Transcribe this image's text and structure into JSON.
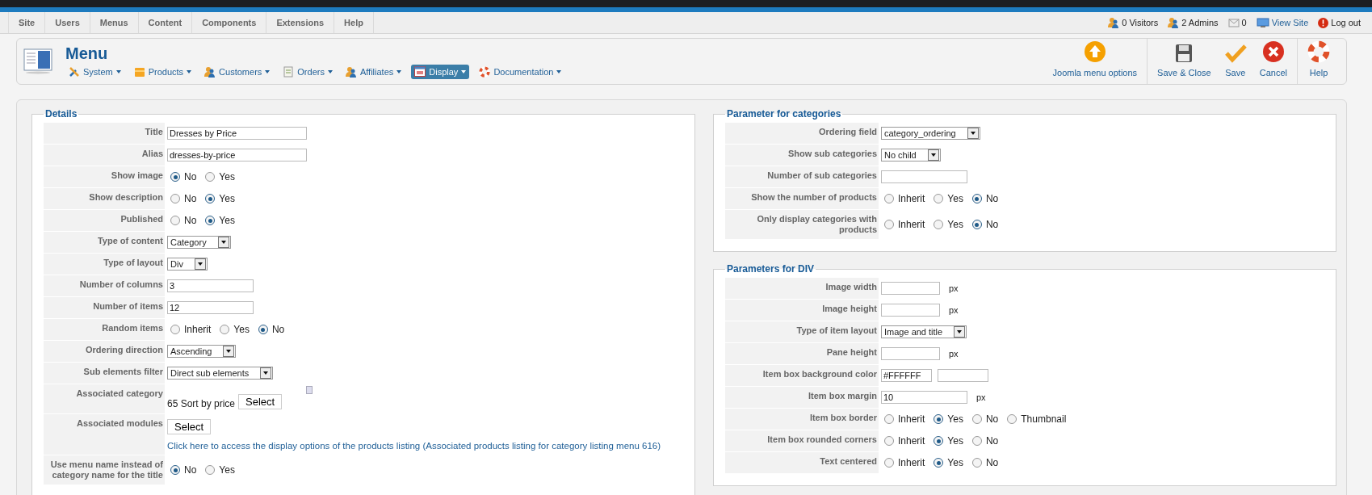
{
  "top_menu": [
    {
      "label": "Site"
    },
    {
      "label": "Users"
    },
    {
      "label": "Menus"
    },
    {
      "label": "Content"
    },
    {
      "label": "Components"
    },
    {
      "label": "Extensions"
    },
    {
      "label": "Help"
    }
  ],
  "status": [
    {
      "kind": "visitors",
      "label": "0 Visitors"
    },
    {
      "kind": "admins",
      "label": "2 Admins"
    },
    {
      "kind": "messages",
      "label": "0"
    },
    {
      "kind": "link",
      "label": "View Site"
    },
    {
      "kind": "logout",
      "label": "Log out"
    }
  ],
  "header": {
    "title": "Menu",
    "nav": [
      {
        "label": "System",
        "selected": false
      },
      {
        "label": "Products",
        "selected": false
      },
      {
        "label": "Customers",
        "selected": false
      },
      {
        "label": "Orders",
        "selected": false
      },
      {
        "label": "Affiliates",
        "selected": false
      },
      {
        "label": "Display",
        "selected": true
      },
      {
        "label": "Documentation",
        "selected": false
      }
    ]
  },
  "toolbar": [
    {
      "buttons": [
        {
          "label": "Joomla menu options"
        }
      ]
    },
    {
      "buttons": [
        {
          "label": "Save & Close"
        },
        {
          "label": "Save"
        },
        {
          "label": "Cancel"
        }
      ]
    },
    {
      "buttons": [
        {
          "label": "Help"
        }
      ]
    }
  ],
  "details": {
    "legend": "Details",
    "rows": [
      {
        "label": "Title",
        "kind": "text",
        "value": "Dresses by Price"
      },
      {
        "label": "Alias",
        "kind": "text",
        "value": "dresses-by-price"
      },
      {
        "label": "Show image",
        "kind": "radio",
        "options": [
          {
            "label": "No",
            "selected": true
          },
          {
            "label": "Yes",
            "selected": false
          }
        ]
      },
      {
        "label": "Show description",
        "kind": "radio",
        "options": [
          {
            "label": "No",
            "selected": false
          },
          {
            "label": "Yes",
            "selected": true
          }
        ]
      },
      {
        "label": "Published",
        "kind": "radio",
        "options": [
          {
            "label": "No",
            "selected": false
          },
          {
            "label": "Yes",
            "selected": true
          }
        ]
      },
      {
        "label": "Type of content",
        "kind": "select",
        "value": "Category"
      },
      {
        "label": "Type of layout",
        "kind": "select",
        "value": "Div"
      },
      {
        "label": "Number of columns",
        "kind": "number",
        "value": "3"
      },
      {
        "label": "Number of items",
        "kind": "number",
        "value": "12"
      },
      {
        "label": "Random items",
        "kind": "radio",
        "options": [
          {
            "label": "Inherit",
            "selected": false
          },
          {
            "label": "Yes",
            "selected": false
          },
          {
            "label": "No",
            "selected": true
          }
        ]
      },
      {
        "label": "Ordering direction",
        "kind": "select",
        "value": "Ascending"
      },
      {
        "label": "Sub elements filter",
        "kind": "select",
        "value": "Direct sub elements"
      },
      {
        "label": "Associated category",
        "kind": "category",
        "value": "65 Sort by price",
        "button": "Select"
      },
      {
        "label": "Associated modules",
        "kind": "modules",
        "button": "Select",
        "link": "Click here to access the display options of the products listing (Associated products listing for category listing menu 616)"
      },
      {
        "label": "Use menu name instead of category name for the title",
        "kind": "radio",
        "options": [
          {
            "label": "No",
            "selected": true
          },
          {
            "label": "Yes",
            "selected": false
          }
        ]
      }
    ]
  },
  "categories": {
    "legend": "Parameter for categories",
    "rows": [
      {
        "label": "Ordering field",
        "kind": "select",
        "value": "category_ordering"
      },
      {
        "label": "Show sub categories",
        "kind": "select",
        "value": "No child"
      },
      {
        "label": "Number of sub categories",
        "kind": "number"
      },
      {
        "label": "Show the number of products",
        "kind": "radio",
        "options": [
          {
            "label": "Inherit",
            "selected": false
          },
          {
            "label": "Yes",
            "selected": false
          },
          {
            "label": "No",
            "selected": true
          }
        ]
      },
      {
        "label": "Only display categories with products",
        "kind": "radio",
        "options": [
          {
            "label": "Inherit",
            "selected": false
          },
          {
            "label": "Yes",
            "selected": false
          },
          {
            "label": "No",
            "selected": true
          }
        ]
      }
    ]
  },
  "div": {
    "legend": "Parameters for DIV",
    "rows": [
      {
        "label": "Image width",
        "kind": "measure",
        "unit": "px"
      },
      {
        "label": "Image height",
        "kind": "measure",
        "unit": "px"
      },
      {
        "label": "Type of item layout",
        "kind": "select",
        "value": "Image and title"
      },
      {
        "label": "Pane height",
        "kind": "measure",
        "unit": "px"
      },
      {
        "label": "Item box background color",
        "kind": "color",
        "value": "#FFFFFF"
      },
      {
        "label": "Item box margin",
        "kind": "number",
        "value": "10",
        "unit": "px"
      },
      {
        "label": "Item box border",
        "kind": "radio",
        "options": [
          {
            "label": "Inherit",
            "selected": false
          },
          {
            "label": "Yes",
            "selected": true
          },
          {
            "label": "No",
            "selected": false
          },
          {
            "label": "Thumbnail",
            "selected": false
          }
        ]
      },
      {
        "label": "Item box rounded corners",
        "kind": "radio",
        "options": [
          {
            "label": "Inherit",
            "selected": false
          },
          {
            "label": "Yes",
            "selected": true
          },
          {
            "label": "No",
            "selected": false
          }
        ]
      },
      {
        "label": "Text centered",
        "kind": "radio",
        "options": [
          {
            "label": "Inherit",
            "selected": false
          },
          {
            "label": "Yes",
            "selected": true
          },
          {
            "label": "No",
            "selected": false
          }
        ]
      }
    ]
  }
}
